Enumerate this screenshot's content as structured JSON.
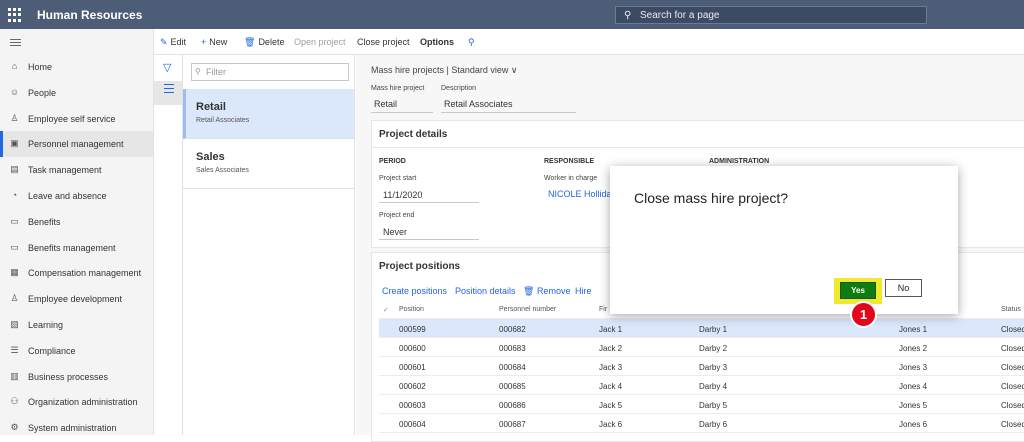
{
  "topbar": {
    "app_name": "Human Resources",
    "search_placeholder": "Search for a page"
  },
  "nav": {
    "items": [
      {
        "label": "Home",
        "icon": "home-icon",
        "glyph": "⌂"
      },
      {
        "label": "People",
        "icon": "people-icon",
        "glyph": "☺"
      },
      {
        "label": "Employee self service",
        "icon": "person-icon",
        "glyph": "♙"
      },
      {
        "label": "Personnel management",
        "icon": "personnel-icon",
        "glyph": "▣"
      },
      {
        "label": "Task management",
        "icon": "task-icon",
        "glyph": "▤"
      },
      {
        "label": "Leave and absence",
        "icon": "leave-icon",
        "glyph": "◔"
      },
      {
        "label": "Benefits",
        "icon": "benefits-icon",
        "glyph": "▭"
      },
      {
        "label": "Benefits management",
        "icon": "benefits-management-icon",
        "glyph": "▭"
      },
      {
        "label": "Compensation management",
        "icon": "compensation-icon",
        "glyph": "▦"
      },
      {
        "label": "Employee development",
        "icon": "development-icon",
        "glyph": "♙"
      },
      {
        "label": "Learning",
        "icon": "learning-icon",
        "glyph": "▧"
      },
      {
        "label": "Compliance",
        "icon": "compliance-icon",
        "glyph": "☰"
      },
      {
        "label": "Business processes",
        "icon": "business-icon",
        "glyph": "▥"
      },
      {
        "label": "Organization administration",
        "icon": "org-icon",
        "glyph": "⚇"
      },
      {
        "label": "System administration",
        "icon": "system-icon",
        "glyph": "⚙"
      }
    ],
    "selected": "Personnel management"
  },
  "toolbar": {
    "edit": "Edit",
    "new": "New",
    "delete": "Delete",
    "open_project": "Open project",
    "close_project": "Close project",
    "options": "Options"
  },
  "list": {
    "filter_placeholder": "Filter",
    "cards": [
      {
        "title": "Retail",
        "subtitle": "Retail Associates"
      },
      {
        "title": "Sales",
        "subtitle": "Sales Associates"
      }
    ]
  },
  "main": {
    "breadcrumb": "Mass hire projects | Standard view ∨",
    "mass_hire_label": "Mass hire project",
    "description_label": "Description",
    "mass_hire_value": "Retail",
    "description_value": "Retail Associates"
  },
  "details": {
    "title": "Project details",
    "period": "PERIOD",
    "responsible": "RESPONSIBLE",
    "administration": "ADMINISTRATION",
    "start_label": "Project start",
    "start_value": "11/1/2020",
    "worker_label": "Worker in charge",
    "worker_value": "NICOLE Holliday",
    "end_label": "Project end",
    "end_value": "Never"
  },
  "positions": {
    "title": "Project positions",
    "actions": {
      "create": "Create positions",
      "details": "Position details",
      "remove": "Remove",
      "hire": "Hire"
    },
    "headers": {
      "position": "Position",
      "personnel": "Personnel number",
      "first": "Fir",
      "status": "Status"
    },
    "rows": [
      {
        "position": "000599",
        "personnel": "000682",
        "first": "Jack 1",
        "middle": "Darby 1",
        "last": "Jones 1",
        "status": "Closed"
      },
      {
        "position": "000600",
        "personnel": "000683",
        "first": "Jack 2",
        "middle": "Darby 2",
        "last": "Jones 2",
        "status": "Closed"
      },
      {
        "position": "000601",
        "personnel": "000684",
        "first": "Jack 3",
        "middle": "Darby 3",
        "last": "Jones 3",
        "status": "Closed"
      },
      {
        "position": "000602",
        "personnel": "000685",
        "first": "Jack 4",
        "middle": "Darby 4",
        "last": "Jones 4",
        "status": "Closed"
      },
      {
        "position": "000603",
        "personnel": "000686",
        "first": "Jack 5",
        "middle": "Darby 5",
        "last": "Jones 5",
        "status": "Closed"
      },
      {
        "position": "000604",
        "personnel": "000687",
        "first": "Jack 6",
        "middle": "Darby 6",
        "last": "Jones 6",
        "status": "Closed"
      }
    ]
  },
  "dialog": {
    "question": "Close mass hire project?",
    "yes": "Yes",
    "no": "No"
  },
  "annotation": {
    "marker": "1"
  },
  "colors": {
    "topbar": "#4d5c77",
    "accent": "#2266e3",
    "yes_button": "#107c10",
    "highlight": "#f2e92e",
    "marker": "#e1061b"
  }
}
